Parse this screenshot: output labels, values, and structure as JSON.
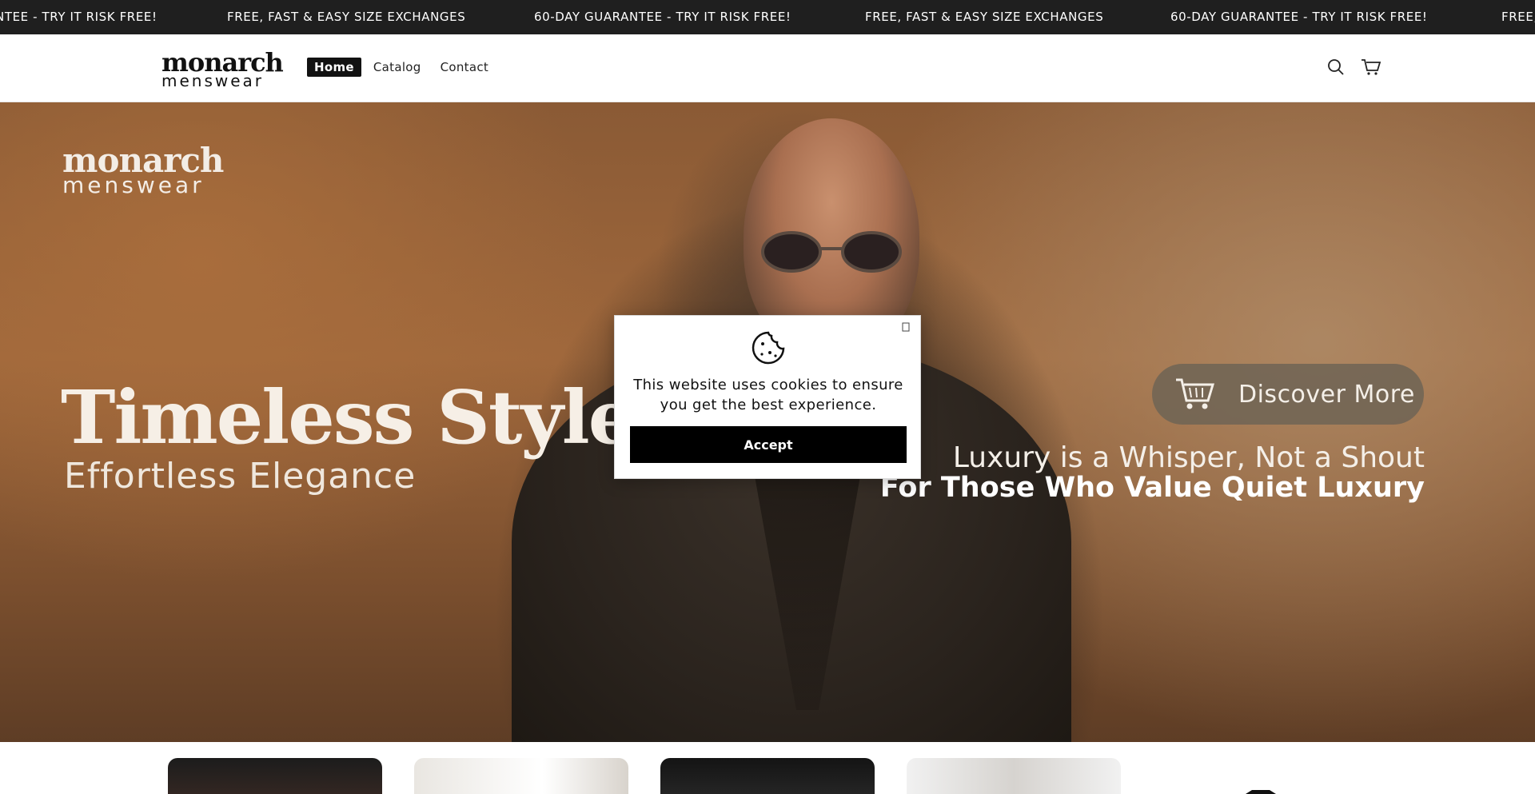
{
  "announcement": {
    "items": [
      "NTEE - TRY IT RISK FREE!",
      "FREE, FAST & EASY SIZE EXCHANGES",
      "60-DAY GUARANTEE - TRY IT RISK FREE!",
      "FREE, FAST & EASY SIZE EXCHANGES",
      "60-DAY GUARANTEE - TRY IT RISK FREE!",
      "FREE,"
    ]
  },
  "header": {
    "logo_top": "monarch",
    "logo_bottom": "menswear",
    "nav": [
      {
        "label": "Home",
        "active": true
      },
      {
        "label": "Catalog",
        "active": false
      },
      {
        "label": "Contact",
        "active": false
      }
    ],
    "icons": [
      "search-icon",
      "cart-icon"
    ]
  },
  "hero": {
    "logo_top": "monarch",
    "logo_bottom": "menswear",
    "headline": "Timeless Style,",
    "subhead": "Effortless Elegance",
    "cta_label": "Discover More",
    "tagline_1": "Luxury is a Whisper, Not a Shout",
    "tagline_2": "For Those Who Value Quiet Luxury"
  },
  "cookie_banner": {
    "message": "This website uses cookies to ensure you get the best experience.",
    "accept_label": "Accept",
    "icons": [
      "cookie-icon",
      "close-icon"
    ]
  },
  "colors": {
    "announcement_bg": "#1f1f1f",
    "nav_active_bg": "#121212",
    "accept_bg": "#000000"
  }
}
